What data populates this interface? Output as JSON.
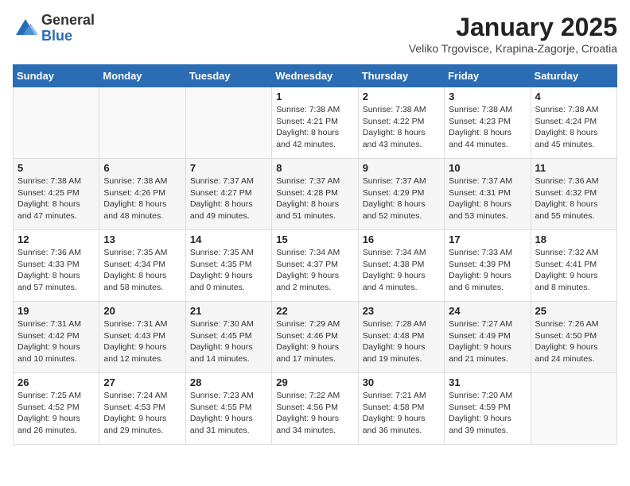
{
  "header": {
    "logo_general": "General",
    "logo_blue": "Blue",
    "month_title": "January 2025",
    "subtitle": "Veliko Trgovisce, Krapina-Zagorje, Croatia"
  },
  "days_of_week": [
    "Sunday",
    "Monday",
    "Tuesday",
    "Wednesday",
    "Thursday",
    "Friday",
    "Saturday"
  ],
  "weeks": [
    [
      {
        "day": "",
        "info": ""
      },
      {
        "day": "",
        "info": ""
      },
      {
        "day": "",
        "info": ""
      },
      {
        "day": "1",
        "info": "Sunrise: 7:38 AM\nSunset: 4:21 PM\nDaylight: 8 hours and 42 minutes."
      },
      {
        "day": "2",
        "info": "Sunrise: 7:38 AM\nSunset: 4:22 PM\nDaylight: 8 hours and 43 minutes."
      },
      {
        "day": "3",
        "info": "Sunrise: 7:38 AM\nSunset: 4:23 PM\nDaylight: 8 hours and 44 minutes."
      },
      {
        "day": "4",
        "info": "Sunrise: 7:38 AM\nSunset: 4:24 PM\nDaylight: 8 hours and 45 minutes."
      }
    ],
    [
      {
        "day": "5",
        "info": "Sunrise: 7:38 AM\nSunset: 4:25 PM\nDaylight: 8 hours and 47 minutes."
      },
      {
        "day": "6",
        "info": "Sunrise: 7:38 AM\nSunset: 4:26 PM\nDaylight: 8 hours and 48 minutes."
      },
      {
        "day": "7",
        "info": "Sunrise: 7:37 AM\nSunset: 4:27 PM\nDaylight: 8 hours and 49 minutes."
      },
      {
        "day": "8",
        "info": "Sunrise: 7:37 AM\nSunset: 4:28 PM\nDaylight: 8 hours and 51 minutes."
      },
      {
        "day": "9",
        "info": "Sunrise: 7:37 AM\nSunset: 4:29 PM\nDaylight: 8 hours and 52 minutes."
      },
      {
        "day": "10",
        "info": "Sunrise: 7:37 AM\nSunset: 4:31 PM\nDaylight: 8 hours and 53 minutes."
      },
      {
        "day": "11",
        "info": "Sunrise: 7:36 AM\nSunset: 4:32 PM\nDaylight: 8 hours and 55 minutes."
      }
    ],
    [
      {
        "day": "12",
        "info": "Sunrise: 7:36 AM\nSunset: 4:33 PM\nDaylight: 8 hours and 57 minutes."
      },
      {
        "day": "13",
        "info": "Sunrise: 7:35 AM\nSunset: 4:34 PM\nDaylight: 8 hours and 58 minutes."
      },
      {
        "day": "14",
        "info": "Sunrise: 7:35 AM\nSunset: 4:35 PM\nDaylight: 9 hours and 0 minutes."
      },
      {
        "day": "15",
        "info": "Sunrise: 7:34 AM\nSunset: 4:37 PM\nDaylight: 9 hours and 2 minutes."
      },
      {
        "day": "16",
        "info": "Sunrise: 7:34 AM\nSunset: 4:38 PM\nDaylight: 9 hours and 4 minutes."
      },
      {
        "day": "17",
        "info": "Sunrise: 7:33 AM\nSunset: 4:39 PM\nDaylight: 9 hours and 6 minutes."
      },
      {
        "day": "18",
        "info": "Sunrise: 7:32 AM\nSunset: 4:41 PM\nDaylight: 9 hours and 8 minutes."
      }
    ],
    [
      {
        "day": "19",
        "info": "Sunrise: 7:31 AM\nSunset: 4:42 PM\nDaylight: 9 hours and 10 minutes."
      },
      {
        "day": "20",
        "info": "Sunrise: 7:31 AM\nSunset: 4:43 PM\nDaylight: 9 hours and 12 minutes."
      },
      {
        "day": "21",
        "info": "Sunrise: 7:30 AM\nSunset: 4:45 PM\nDaylight: 9 hours and 14 minutes."
      },
      {
        "day": "22",
        "info": "Sunrise: 7:29 AM\nSunset: 4:46 PM\nDaylight: 9 hours and 17 minutes."
      },
      {
        "day": "23",
        "info": "Sunrise: 7:28 AM\nSunset: 4:48 PM\nDaylight: 9 hours and 19 minutes."
      },
      {
        "day": "24",
        "info": "Sunrise: 7:27 AM\nSunset: 4:49 PM\nDaylight: 9 hours and 21 minutes."
      },
      {
        "day": "25",
        "info": "Sunrise: 7:26 AM\nSunset: 4:50 PM\nDaylight: 9 hours and 24 minutes."
      }
    ],
    [
      {
        "day": "26",
        "info": "Sunrise: 7:25 AM\nSunset: 4:52 PM\nDaylight: 9 hours and 26 minutes."
      },
      {
        "day": "27",
        "info": "Sunrise: 7:24 AM\nSunset: 4:53 PM\nDaylight: 9 hours and 29 minutes."
      },
      {
        "day": "28",
        "info": "Sunrise: 7:23 AM\nSunset: 4:55 PM\nDaylight: 9 hours and 31 minutes."
      },
      {
        "day": "29",
        "info": "Sunrise: 7:22 AM\nSunset: 4:56 PM\nDaylight: 9 hours and 34 minutes."
      },
      {
        "day": "30",
        "info": "Sunrise: 7:21 AM\nSunset: 4:58 PM\nDaylight: 9 hours and 36 minutes."
      },
      {
        "day": "31",
        "info": "Sunrise: 7:20 AM\nSunset: 4:59 PM\nDaylight: 9 hours and 39 minutes."
      },
      {
        "day": "",
        "info": ""
      }
    ]
  ]
}
